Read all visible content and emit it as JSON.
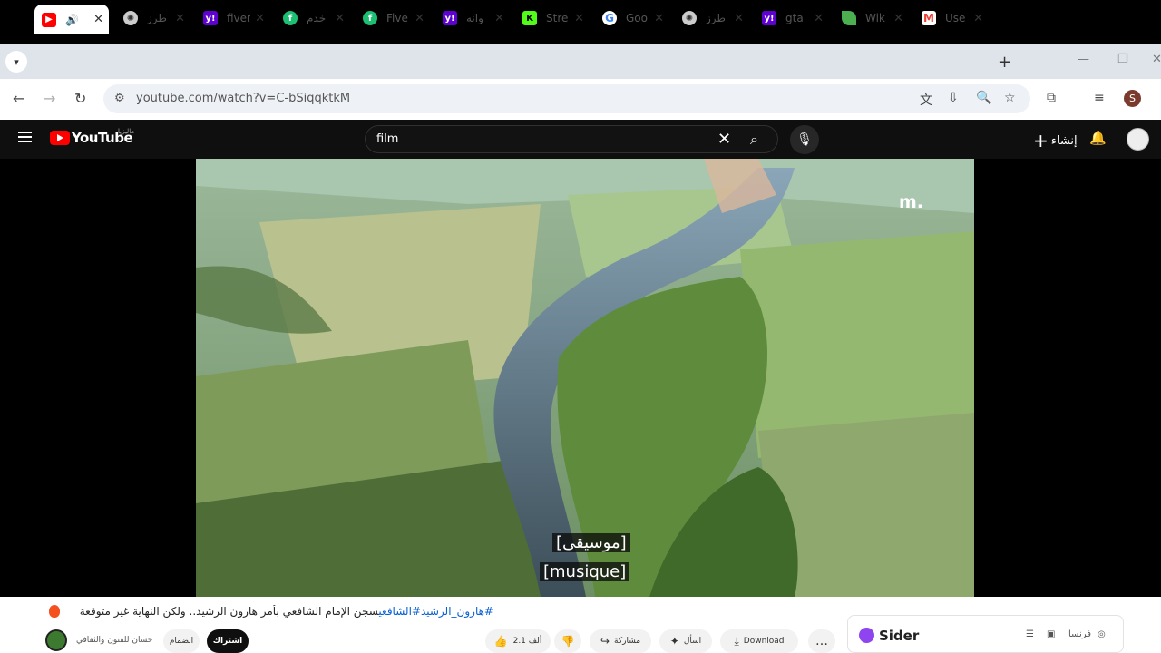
{
  "browser": {
    "tabs": [
      {
        "label": "",
        "icon": "youtube-icon",
        "audio": true,
        "active": true
      },
      {
        "label": "طرز",
        "icon": "chatgpt-icon"
      },
      {
        "label": "fiver",
        "icon": "yahoo-icon"
      },
      {
        "label": "خدم",
        "icon": "fiverr-icon"
      },
      {
        "label": "Five",
        "icon": "fiverr-icon"
      },
      {
        "label": "وانه",
        "icon": "yahoo-icon"
      },
      {
        "label": "Stre",
        "icon": "kick-icon"
      },
      {
        "label": "Goo",
        "icon": "google-icon"
      },
      {
        "label": "طرز",
        "icon": "chatgpt-icon"
      },
      {
        "label": "gta",
        "icon": "yahoo-icon"
      },
      {
        "label": "Wik",
        "icon": "leaf-icon"
      },
      {
        "label": "Use",
        "icon": "gmail-icon"
      }
    ],
    "url": "youtube.com/watch?v=C-bSiqqktkM",
    "profile_initial": "S"
  },
  "youtube": {
    "logo_text": "YouTube",
    "country_code": "ماليزيا",
    "search_query": "film",
    "create_label": "إنشاء"
  },
  "video": {
    "watermark": "m.",
    "subtitle_ar": "[موسيقى]",
    "subtitle_fr": "[musique]"
  },
  "below": {
    "tags": "#هارون_الرشيد#الشافعي",
    "title_text": "سجن الإمام الشافعي بأمر هارون الرشيد.. ولكن النهاية غير متوقعة",
    "channel_name": "حسان للفنون والثقافي",
    "join_label": "انضمام",
    "subscribe_label": "اشتراك",
    "like_count": "2.1 ألف",
    "share_label": "مشاركة",
    "ask_label": "اسأل",
    "download_label": "Download",
    "more_label": "…"
  },
  "sider": {
    "name": "Sider",
    "lang": "فرنسا"
  }
}
